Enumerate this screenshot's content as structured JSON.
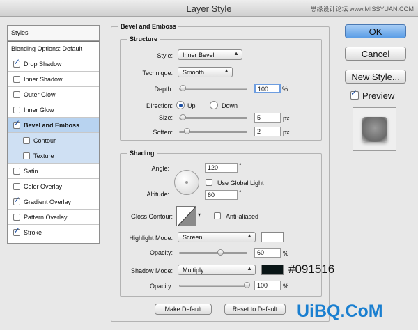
{
  "window": {
    "title": "Layer Style",
    "watermark": "思缘设计论坛 www.MISSYUAN.COM"
  },
  "sidebar": {
    "header": "Styles",
    "blending": "Blending Options: Default",
    "items": [
      {
        "label": "Drop Shadow",
        "checked": true
      },
      {
        "label": "Inner Shadow",
        "checked": false
      },
      {
        "label": "Outer Glow",
        "checked": false
      },
      {
        "label": "Inner Glow",
        "checked": false
      },
      {
        "label": "Bevel and Emboss",
        "checked": true
      },
      {
        "label": "Contour",
        "checked": false
      },
      {
        "label": "Texture",
        "checked": false
      },
      {
        "label": "Satin",
        "checked": false
      },
      {
        "label": "Color Overlay",
        "checked": false
      },
      {
        "label": "Gradient Overlay",
        "checked": true
      },
      {
        "label": "Pattern Overlay",
        "checked": false
      },
      {
        "label": "Stroke",
        "checked": true
      }
    ]
  },
  "panel": {
    "title": "Bevel and Emboss",
    "structure": {
      "title": "Structure",
      "style_label": "Style:",
      "style_value": "Inner Bevel",
      "technique_label": "Technique:",
      "technique_value": "Smooth",
      "depth_label": "Depth:",
      "depth_value": "100",
      "depth_unit": "%",
      "depth_level": 1.0,
      "direction_label": "Direction:",
      "dir_up": "Up",
      "dir_down": "Down",
      "size_label": "Size:",
      "size_value": "5",
      "size_unit": "px",
      "soften_label": "Soften:",
      "soften_value": "2",
      "soften_unit": "px"
    },
    "shading": {
      "title": "Shading",
      "angle_label": "Angle:",
      "angle_value": "120",
      "angle_unit": "°",
      "global_light": "Use Global Light",
      "altitude_label": "Altitude:",
      "altitude_value": "60",
      "altitude_unit": "°",
      "gloss_label": "Gloss Contour:",
      "anti_aliased": "Anti-aliased",
      "highlight_label": "Highlight Mode:",
      "highlight_value": "Screen",
      "highlight_color": "#ffffff",
      "hl_opacity_label": "Opacity:",
      "hl_opacity_value": "60",
      "hl_opacity_unit": "%",
      "shadow_label": "Shadow Mode:",
      "shadow_value": "Multiply",
      "shadow_color": "#091516",
      "sh_opacity_label": "Opacity:",
      "sh_opacity_value": "100",
      "sh_opacity_unit": "%",
      "shadow_hex": "#091516"
    },
    "make_default": "Make Default",
    "reset_default": "Reset to Default"
  },
  "buttons": {
    "ok": "OK",
    "cancel": "Cancel",
    "new_style": "New Style...",
    "preview": "Preview"
  },
  "brand": "UiBQ.CoM"
}
